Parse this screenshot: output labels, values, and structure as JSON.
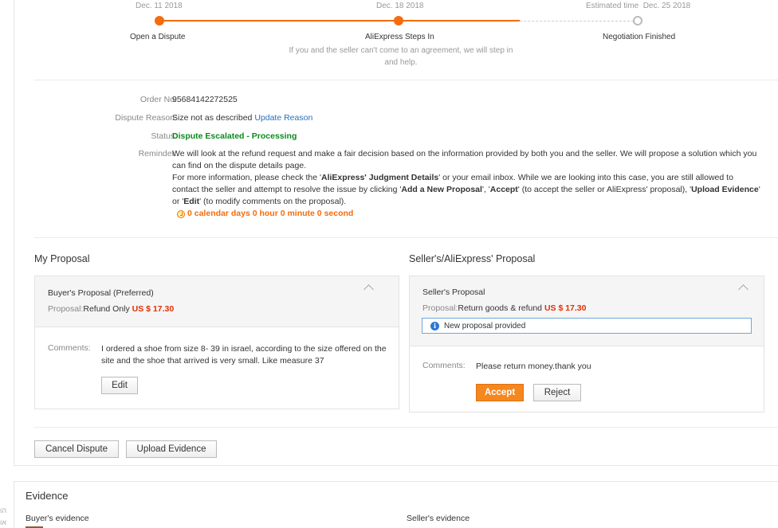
{
  "progress": {
    "steps": [
      {
        "date": "Dec. 11 2018",
        "label": "Open a Dispute"
      },
      {
        "date": "Dec. 18 2018",
        "label": "AliExpress Steps In",
        "sub": "If you and the seller can't come to an agreement, we will step in and help."
      },
      {
        "date_prefix": "Estimated time",
        "date": "Dec. 25 2018",
        "label": "Negotiation Finished"
      }
    ],
    "accent": "#f56c0c"
  },
  "info": {
    "order_label": "Order No:",
    "order_value": "95684142272525",
    "reason_label": "Dispute Reason:",
    "reason_value": "Size not as described",
    "reason_link": "Update Reason",
    "status_label": "Status:",
    "status_value": "Dispute Escalated - Processing",
    "reminder_label": "Reminder:",
    "reminder_p1": "We will look at the refund request and make a fair decision based on the information provided by both you and the seller. We will propose a solution which you can find on the dispute details page.",
    "reminder_p2a": "For more information, please check the '",
    "reminder_p2b": "AliExpress' Judgment Details",
    "reminder_p2c": "' or your email inbox. While we are looking into this case, you are still allowed to contact the seller and attempt to resolve the issue by clicking '",
    "reminder_p2d": "Add a New Proposal",
    "reminder_p2e": "', '",
    "reminder_p2f": "Accept",
    "reminder_p2g": "' (to accept the seller or AliExpress' proposal), '",
    "reminder_p2h": "Upload Evidence",
    "reminder_p2i": "' or '",
    "reminder_p2j": "Edit",
    "reminder_p2k": "' (to modify comments on the proposal).",
    "countdown": "0 calendar days 0 hour 0 minute 0 second"
  },
  "my_proposal": {
    "heading": "My Proposal",
    "title": "Buyer's Proposal (Preferred)",
    "proposal_label": "Proposal:",
    "proposal_value": "Refund Only",
    "amount": "US $ 17.30",
    "comments_label": "Comments:",
    "comments_text": "I ordered a shoe from size 8- 39 in israel, according to the size offered on the site and the shoe that arrived is very small. Like measure 37",
    "edit_label": "Edit"
  },
  "seller_proposal": {
    "heading": "Seller's/AliExpress' Proposal",
    "title": "Seller's Proposal",
    "proposal_label": "Proposal:",
    "proposal_value": "Return goods & refund",
    "amount": "US $ 17.30",
    "notice": "New proposal provided",
    "comments_label": "Comments:",
    "comments_text": "Please return money.thank you",
    "accept_label": "Accept",
    "reject_label": "Reject"
  },
  "actions": {
    "cancel_label": "Cancel Dispute",
    "upload_label": "Upload Evidence"
  },
  "evidence": {
    "title": "Evidence",
    "buyer": "Buyer's evidence",
    "seller": "Seller's evidence"
  },
  "edge": {
    "line1": "הו",
    "line2": "או"
  }
}
